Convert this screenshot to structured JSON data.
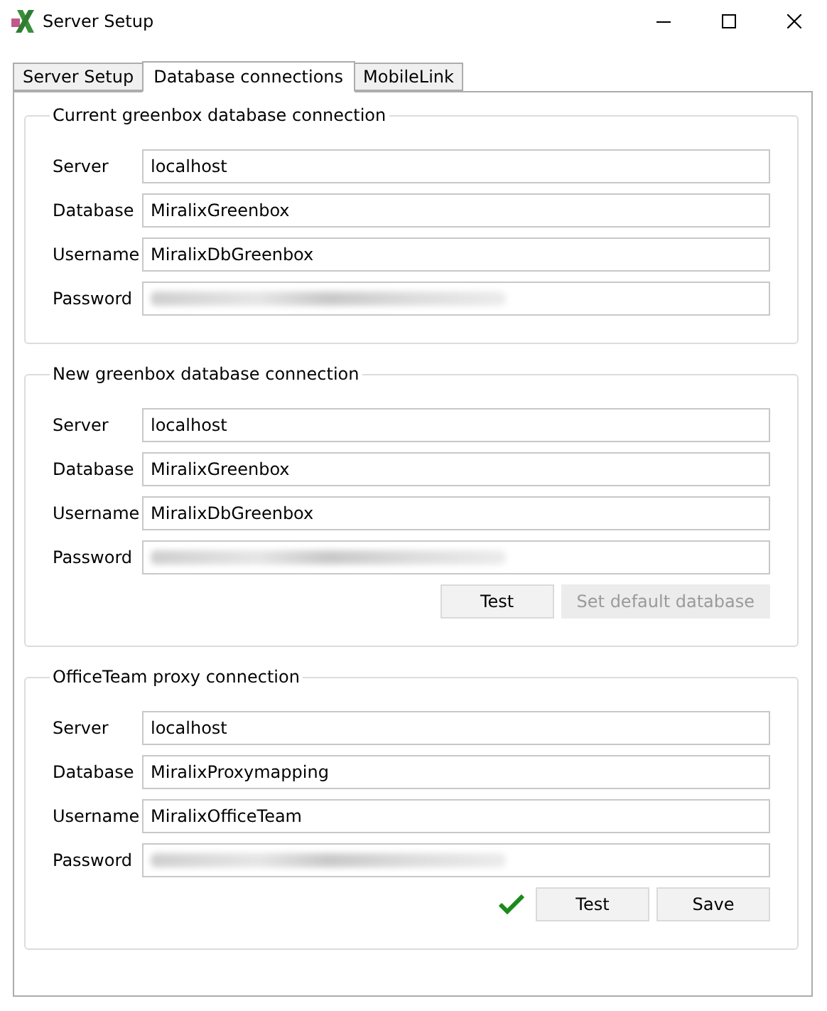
{
  "window": {
    "title": "Server Setup"
  },
  "tabs": [
    {
      "label": "Server Setup",
      "selected": false
    },
    {
      "label": "Database connections",
      "selected": true
    },
    {
      "label": "MobileLink",
      "selected": false
    }
  ],
  "groups": [
    {
      "title": "Current greenbox database connection",
      "fields": [
        {
          "label": "Server",
          "value": "localhost",
          "blurred": false
        },
        {
          "label": "Database",
          "value": "MiralixGreenbox",
          "blurred": false
        },
        {
          "label": "Username",
          "value": "MiralixDbGreenbox",
          "blurred": false
        },
        {
          "label": "Password",
          "blurred": true
        }
      ]
    },
    {
      "title": "New greenbox database connection",
      "fields": [
        {
          "label": "Server",
          "value": "localhost",
          "blurred": false
        },
        {
          "label": "Database",
          "value": "MiralixGreenbox",
          "blurred": false
        },
        {
          "label": "Username",
          "value": "MiralixDbGreenbox",
          "blurred": false
        },
        {
          "label": "Password",
          "blurred": true
        }
      ],
      "buttons": [
        {
          "label": "Test",
          "disabled": false
        },
        {
          "label": "Set default database",
          "disabled": true
        }
      ]
    },
    {
      "title": "OfficeTeam proxy connection",
      "fields": [
        {
          "label": "Server",
          "value": "localhost",
          "blurred": false
        },
        {
          "label": "Database",
          "value": "MiralixProxymapping",
          "blurred": false
        },
        {
          "label": "Username",
          "value": "MiralixOfficeTeam",
          "blurred": false
        },
        {
          "label": "Password",
          "blurred": true
        }
      ],
      "status": {
        "kind": "ok"
      },
      "buttons": [
        {
          "label": "Test",
          "disabled": false
        },
        {
          "label": "Save",
          "disabled": false
        }
      ]
    }
  ]
}
